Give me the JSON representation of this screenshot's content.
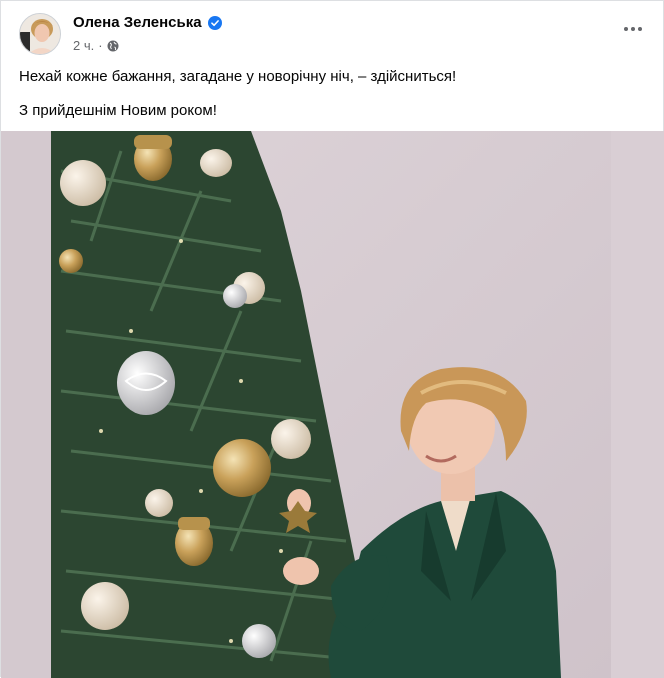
{
  "post": {
    "author": "Олена Зеленська",
    "time": "2 ч.",
    "separator": "·",
    "icons": {
      "verified": "verified-badge-icon",
      "audience": "globe-icon",
      "more": "more-options-icon"
    },
    "text_lines": [
      "Нехай кожне бажання, загадане у новорічну ніч, – здійсниться!",
      "З прийдешнім Новим роком!"
    ]
  },
  "colors": {
    "verified": "#1877f2",
    "secondary_text": "#65676b",
    "photo_background": "#d7cdd2",
    "tree": "#2f4a34",
    "blazer": "#1f4a3a"
  }
}
